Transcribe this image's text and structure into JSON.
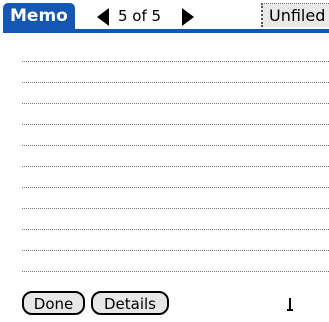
{
  "app": {
    "title": "Memo",
    "counter": "5 of 5",
    "category": "Unfiled"
  },
  "icons": {
    "prev": "triangle-left-icon",
    "next": "triangle-right-icon",
    "cursor": "text-cursor-icon"
  },
  "buttons": {
    "done_label": "Done",
    "details_label": "Details"
  },
  "colors": {
    "title_bar": "#1456b4",
    "button_fill": "#e7e7e7"
  }
}
